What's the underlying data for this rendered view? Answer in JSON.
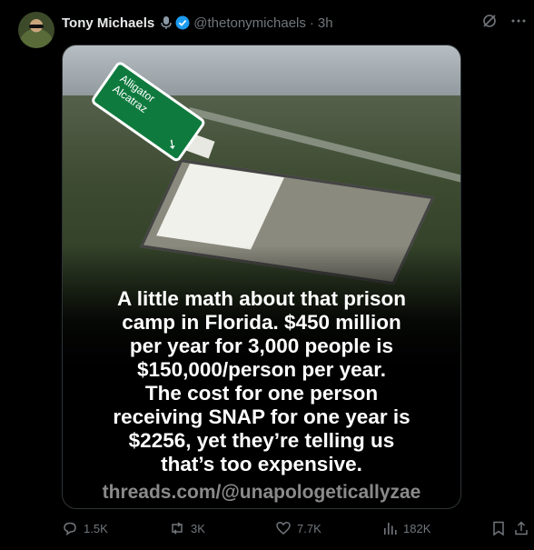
{
  "post": {
    "author_name": "Tony Michaels",
    "handle": "@thetonymichaels",
    "separator": "·",
    "time": "3h",
    "image": {
      "sign_line1": "Alligator",
      "sign_line2": "Alcatraz",
      "caption_lines": [
        "A little math about that prison",
        "camp in Florida. $450 million",
        "per year for 3,000 people is",
        "$150,000/person per year.",
        "The cost for one person",
        "receiving SNAP for one year is",
        "$2256, yet they’re telling us",
        "that’s too expensive."
      ],
      "credit": "threads.com/@unapologeticallyzae"
    },
    "actions": {
      "replies": "1.5K",
      "reposts": "3K",
      "likes": "7.7K",
      "views": "182K"
    }
  },
  "colors": {
    "verified": "#1d9bf0",
    "muted": "#71767b",
    "sign_green": "#0f7a3e"
  }
}
